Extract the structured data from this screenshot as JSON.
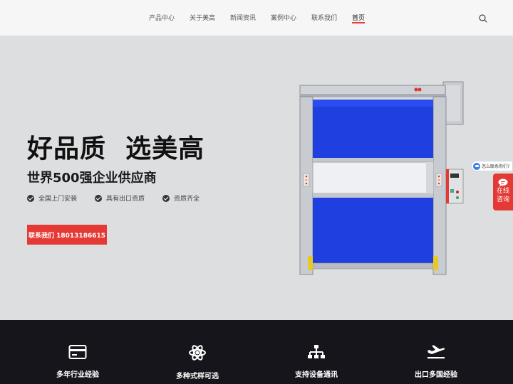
{
  "nav": {
    "items": [
      "产品中心",
      "关于美高",
      "新闻资讯",
      "案例中心",
      "联系我们",
      "首页"
    ],
    "active": "首页"
  },
  "hero": {
    "title": "好品质  选美高",
    "subtitle": "世界500强企业供应商",
    "features": [
      "全国上门安装",
      "具有出口资质",
      "资质齐全"
    ],
    "cta": "联系我们 18013186615"
  },
  "side": {
    "chat_prompt": "怎么联系你们?",
    "consult_line1": "在线",
    "consult_line2": "咨询"
  },
  "advantages": [
    {
      "icon": "credit-card-icon",
      "label": "多年行业经验"
    },
    {
      "icon": "atom-icon",
      "label": "多种式样可选"
    },
    {
      "icon": "network-icon",
      "label": "支持设备通讯"
    },
    {
      "icon": "airplane-icon",
      "label": "出口多国经验"
    }
  ],
  "colors": {
    "accent": "#e53935",
    "door_blue": "#1f3fe0",
    "hero_bg": "#dddee0",
    "dark_strip": "#16151b"
  }
}
